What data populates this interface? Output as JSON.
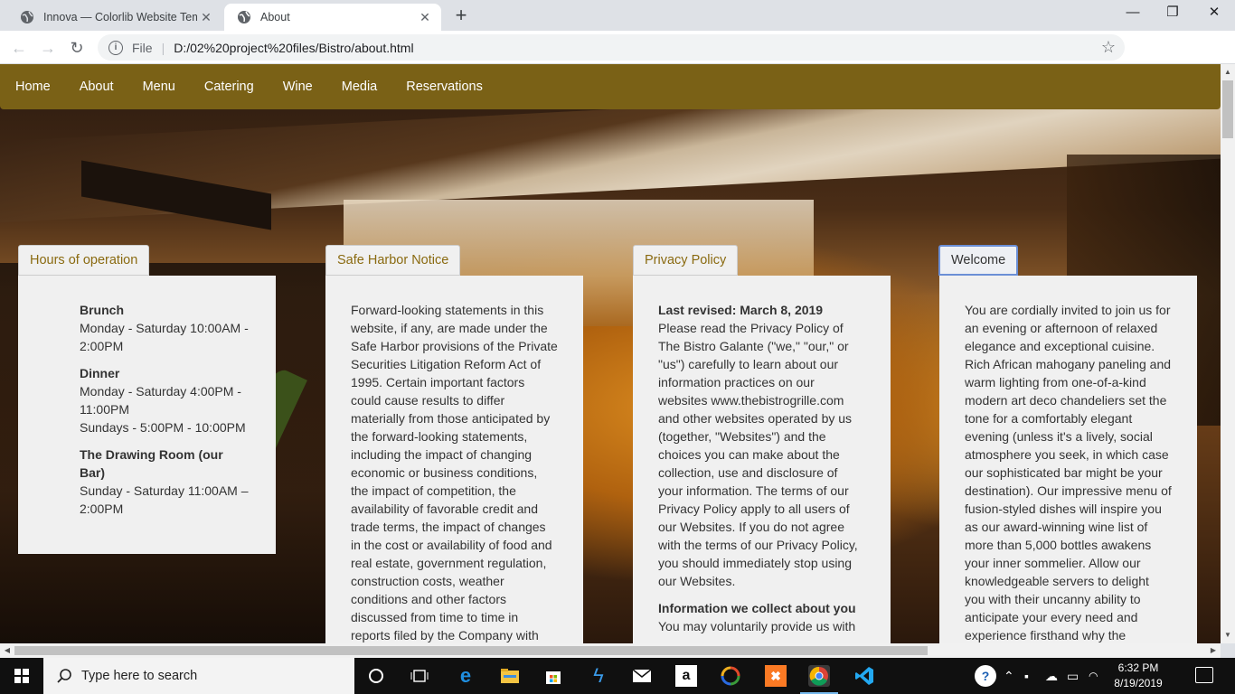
{
  "browser": {
    "tabs": [
      {
        "title": "Innova — Colorlib Website Temp",
        "active": false
      },
      {
        "title": "About",
        "active": true
      }
    ],
    "new_tab": "+",
    "url_scheme": "File",
    "url": "D:/02%20project%20files/Bistro/about.html",
    "window_controls": {
      "minimize": "—",
      "maximize": "❐",
      "close": "✕"
    }
  },
  "nav": {
    "items": [
      "Home",
      "About",
      "Menu",
      "Catering",
      "Wine",
      "Media",
      "Reservations"
    ],
    "background": "#7a6116"
  },
  "cards": {
    "hours": {
      "tab": "Hours of operation",
      "blocks": [
        {
          "heading": "Brunch",
          "lines": [
            "Monday - Saturday 10:00AM - 2:00PM"
          ]
        },
        {
          "heading": "Dinner",
          "lines": [
            "Monday - Saturday 4:00PM - 11:00PM",
            "Sundays - 5:00PM - 10:00PM"
          ]
        },
        {
          "heading": "The Drawing Room (our Bar)",
          "lines": [
            "Sunday - Saturday 11:00AM – 2:00PM"
          ]
        }
      ]
    },
    "safe_harbor": {
      "tab": "Safe Harbor Notice",
      "text": "Forward-looking statements in this website, if any, are made under the Safe Harbor provisions of the Private Securities Litigation Reform Act of 1995. Certain important factors could cause results to differ materially from those anticipated by the forward-looking statements, including the impact of changing economic or business conditions, the impact of competition, the availability of favorable credit and trade terms, the impact of changes in the cost or availability of food and real estate, government regulation, construction costs, weather conditions and other factors discussed from time to time in reports filed by the Company with"
    },
    "privacy": {
      "tab": "Privacy Policy",
      "revised": "Last revised: March 8, 2019",
      "text": "Please read the Privacy Policy of The Bistro Galante (\"we,\" \"our,\" or \"us\") carefully to learn about our information practices on our websites www.thebistrogrille.com and other websites operated by us (together, \"Websites\") and the choices you can make about the collection, use and disclosure of your information. The terms of our Privacy Policy apply to all users of our Websites. If you do not agree with the terms of our Privacy Policy, you should immediately stop using our Websites.",
      "subheading": "Information we collect about you",
      "subtext": "You may voluntarily provide us with"
    },
    "welcome": {
      "tab": "Welcome",
      "text": "You are cordially invited to join us for an evening or afternoon of relaxed elegance and exceptional cuisine. Rich African mahogany paneling and warm lighting from one-of-a-kind modern art deco chandeliers set the tone for a comfortably elegant evening (unless it's a lively, social atmosphere you seek, in which case our sophisticated bar might be your destination). Our impressive menu of fusion-styled dishes will inspire you as our award-winning wine list of more than 5,000 bottles awakens your inner sommelier. Allow our knowledgeable servers to delight you with their uncanny ability to anticipate your every need and experience firsthand why the"
    }
  },
  "taskbar": {
    "search_placeholder": "Type here to search",
    "time": "6:32 PM",
    "date": "8/19/2019"
  }
}
